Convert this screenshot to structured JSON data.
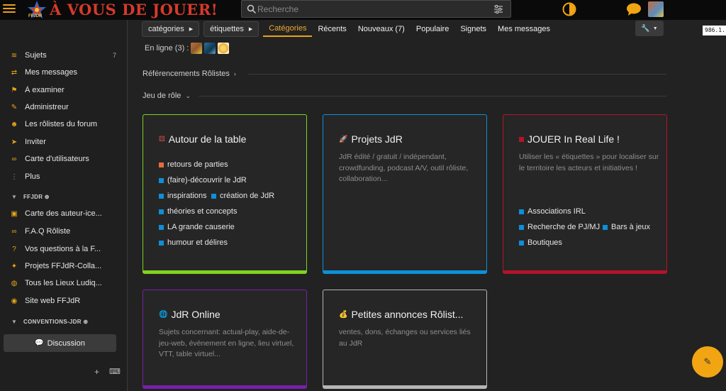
{
  "app": {
    "logo_text": "À VOUS DE JOUER!",
    "logo_sub": "FFJDR",
    "search_placeholder": "Recherche",
    "coord_readout": "986.1..."
  },
  "colors": {
    "accent": "#e8a317",
    "logo_red": "#d63a2a"
  },
  "sidebar": {
    "items": [
      {
        "label": "Sujets",
        "icon": "layers-icon",
        "count": "7"
      },
      {
        "label": "Mes messages",
        "icon": "exchange-icon"
      },
      {
        "label": "À examiner",
        "icon": "flag-icon"
      },
      {
        "label": "Administreur",
        "icon": "wrench-icon"
      },
      {
        "label": "Les rôlistes du forum",
        "icon": "users-icon"
      },
      {
        "label": "Inviter",
        "icon": "send-icon"
      },
      {
        "label": "Carte d'utilisateurs",
        "icon": "link-icon"
      },
      {
        "label": "Plus",
        "icon": "ellipsis-vertical-icon"
      }
    ],
    "section_ffjdr": "FFJDR ⊕",
    "ffjdr_items": [
      {
        "label": "Carte des auteur-ice...",
        "icon": "cubes-icon"
      },
      {
        "label": "F.A.Q Rôliste",
        "icon": "link-icon"
      },
      {
        "label": "Vos questions à la F...",
        "icon": "question-icon"
      },
      {
        "label": "Projets FFJdR-Colla...",
        "icon": "magic-wand-icon"
      },
      {
        "label": "Tous les Lieux Ludiq...",
        "icon": "globe-icon"
      },
      {
        "label": "Site web FFJdR",
        "icon": "eye-icon"
      }
    ],
    "section_conventions": "CONVENTIONS-JDR ⊕",
    "discussion_label": "Discussion",
    "footer_plus": "+",
    "footer_keyboard": "⌨"
  },
  "nav": {
    "dropdown_categories": "catégories",
    "dropdown_tags": "étiquettes",
    "tabs": [
      "Catégories",
      "Récents",
      "Nouveaux (7)",
      "Populaire",
      "Signets",
      "Mes messages"
    ],
    "active_tab": "Catégories"
  },
  "online": {
    "label": "En ligne (3) :"
  },
  "sections": {
    "references": "Référencements Rôlistes",
    "jeu_de_role": "Jeu de rôle"
  },
  "cards": [
    {
      "title": "Autour de la table",
      "color": "#7ed321",
      "subs": [
        "retours de parties",
        "(faire)-découvrir le JdR",
        "inspirations",
        "création de JdR",
        "théories et concepts",
        "LA grande causerie",
        "humour et délires"
      ]
    },
    {
      "title": "Projets JdR",
      "color": "#0d8fd9",
      "desc": "JdR édité / gratuit / indépendant, crowdfunding, podcast A/V, outil rôliste, collaboration..."
    },
    {
      "title": "JOUER In Real Life !",
      "color": "#b3142a",
      "desc": "Utiliser les « étiquettes » pour localiser sur le territoire les acteurs et initiatives !",
      "subs": [
        "Associations IRL",
        "Recherche de PJ/MJ",
        "Bars à jeux",
        "Boutiques"
      ]
    },
    {
      "title": "JdR Online",
      "color": "#7a1fa8",
      "desc": "Sujets concernant: actual-play, aide-de-jeu-web, évènement en ligne, lieu virtuel, VTT, table virtuel..."
    },
    {
      "title": "Petites annonces Rôlist...",
      "color": "#b5b5b5",
      "desc": "ventes, dons, échanges ou services liés au JdR"
    }
  ]
}
